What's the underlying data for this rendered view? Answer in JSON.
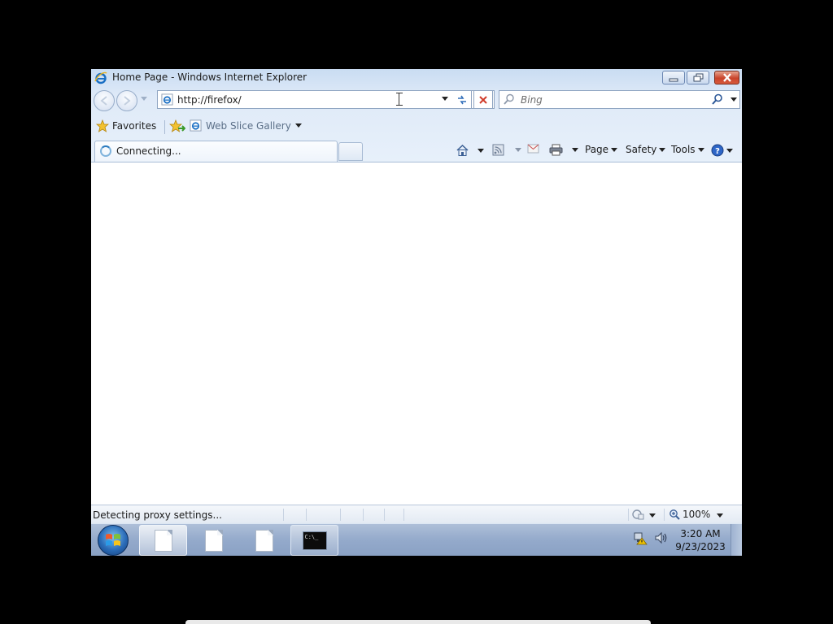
{
  "window": {
    "title": "Home Page - Windows Internet Explorer"
  },
  "navigation": {
    "address": "http://firefox/",
    "search_placeholder": "Bing"
  },
  "favorites_bar": {
    "favorites_label": "Favorites",
    "web_slice_label": "Web Slice Gallery"
  },
  "tab": {
    "title": "Connecting..."
  },
  "command_bar": {
    "page_label": "Page",
    "safety_label": "Safety",
    "tools_label": "Tools"
  },
  "status_bar": {
    "text": "Detecting proxy settings...",
    "zoom": "100%"
  },
  "taskbar": {
    "time": "3:20 AM",
    "date": "9/23/2023",
    "console_glyph": "C:\\_"
  },
  "colors": {
    "frame": "#dfeaf8",
    "taskbar": "#94aacb",
    "close_button": "#c9442c"
  },
  "icons": [
    "ie-icon",
    "minimize-icon",
    "maximize-icon",
    "close-icon",
    "back-icon",
    "forward-icon",
    "refresh-icon",
    "stop-icon",
    "search-icon",
    "star-icon",
    "add-favorite-icon",
    "web-slice-icon",
    "loading-spinner-icon",
    "home-icon",
    "feed-icon",
    "mail-icon",
    "print-icon",
    "help-icon",
    "protected-mode-icon",
    "zoom-icon",
    "start-orb-icon",
    "document-icon",
    "console-icon",
    "network-icon",
    "speaker-icon"
  ]
}
